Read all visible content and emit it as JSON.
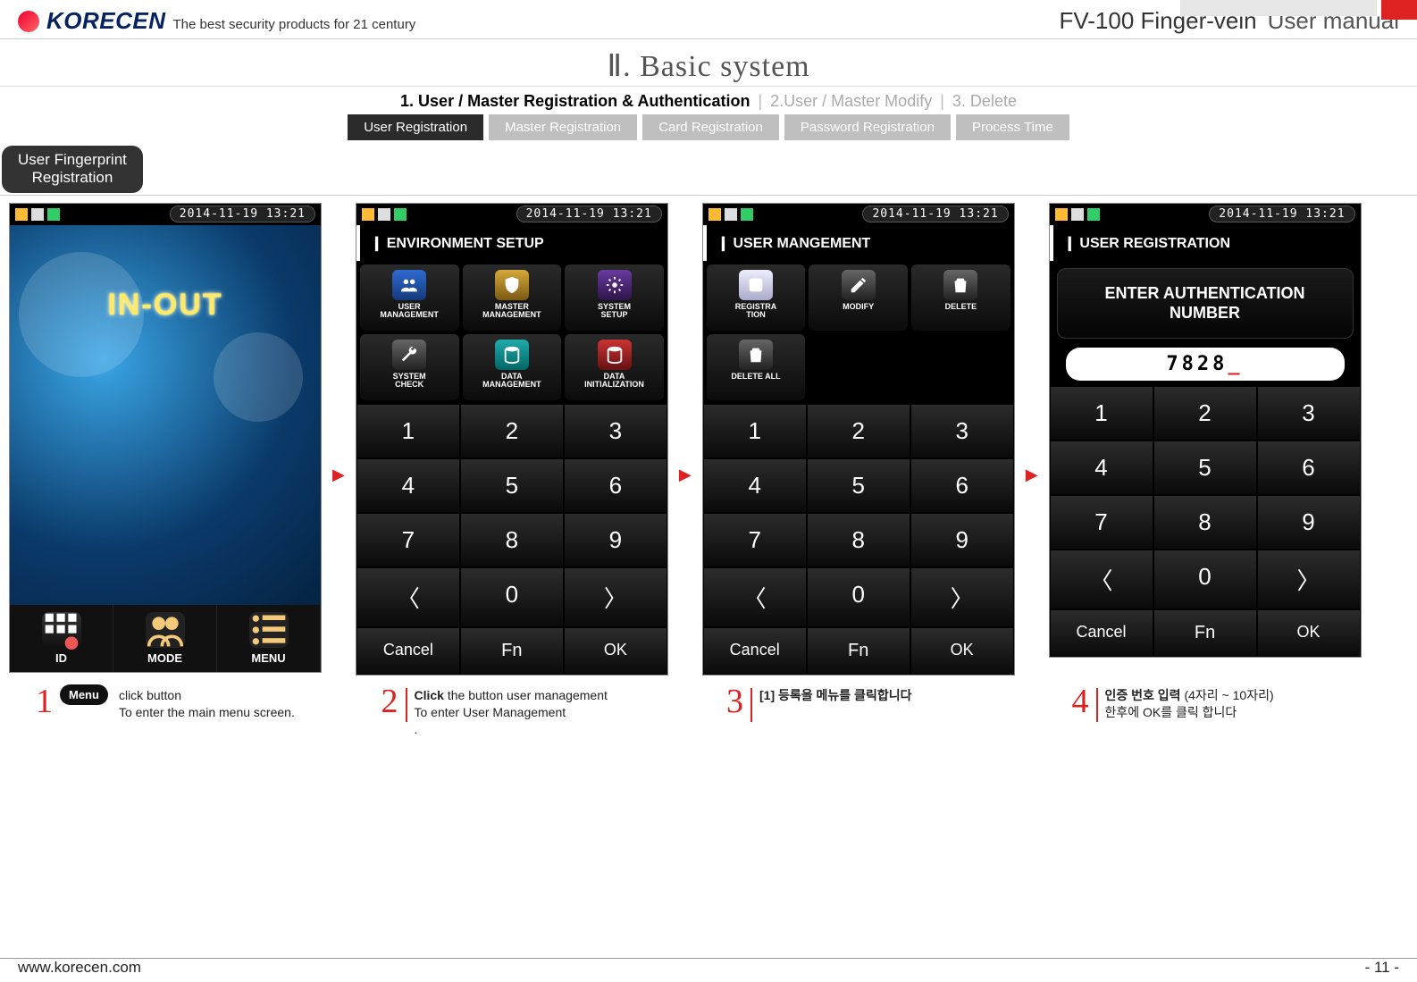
{
  "header": {
    "logo_text": "KORECEN",
    "tagline": "The best security products for 21 century",
    "product": "FV-100 Finger-vein",
    "doc_type": "User manual"
  },
  "page_title": "Ⅱ. Basic system",
  "breadcrumb": {
    "active": "1. User / Master Registration & Authentication",
    "item2": "2.User / Master Modify",
    "item3": "3. Delete"
  },
  "subtabs": {
    "t1": "User Registration",
    "t2": "Master Registration",
    "t3": "Card Registration",
    "t4": "Password Registration",
    "t5": "Process Time"
  },
  "section_label": "User Fingerprint\nRegistration",
  "status": {
    "datetime": "2014-11-19  13:21"
  },
  "screen1": {
    "title": "IN-OUT",
    "btns": {
      "id": "ID",
      "mode": "MODE",
      "menu": "MENU"
    }
  },
  "screen2": {
    "header": "ENVIRONMENT SETUP",
    "icons": {
      "i1": "USER\nMANAGEMENT",
      "i2": "MASTER\nMANAGEMENT",
      "i3": "SYSTEM\nSETUP",
      "i4": "SYSTEM\nCHECK",
      "i5": "DATA\nMANAGEMENT",
      "i6": "DATA\nINITIALIZATION"
    }
  },
  "screen3": {
    "header": "USER MANGEMENT",
    "icons": {
      "i1": "REGISTRA\nTION",
      "i2": "MODIFY",
      "i3": "DELETE",
      "i4": "DELETE ALL"
    }
  },
  "screen4": {
    "header": "USER REGISTRATION",
    "prompt": "ENTER AUTHENTICATION\nNUMBER",
    "value": "7828"
  },
  "keypad": {
    "k1": "1",
    "k2": "2",
    "k3": "3",
    "k4": "4",
    "k5": "5",
    "k6": "6",
    "k7": "7",
    "k8": "8",
    "k9": "9",
    "left": "〈",
    "k0": "0",
    "right": "〉",
    "cancel": "Cancel",
    "fn": "Fn",
    "ok": "OK"
  },
  "steps": {
    "s1_num": "1",
    "s1_badge": "Menu",
    "s1_l1": " click button",
    "s1_l2": "To enter the main menu screen.",
    "s2_num": "2",
    "s2_l1a": "Click",
    "s2_l1b": " the button user management",
    "s2_l2": "To enter User Management",
    "s2_l3": ".",
    "s3_num": "3",
    "s3_l1a": "[1] 등록을 메뉴를 클릭합니다",
    "s4_num": "4",
    "s4_l1a": "인증 번호 입력",
    "s4_l1b": " (4자리 ~ 10자리)",
    "s4_l2": "한후에 OK를 클릭 합니다"
  },
  "footer": {
    "url": "www.korecen.com",
    "page": "- 11 -"
  }
}
